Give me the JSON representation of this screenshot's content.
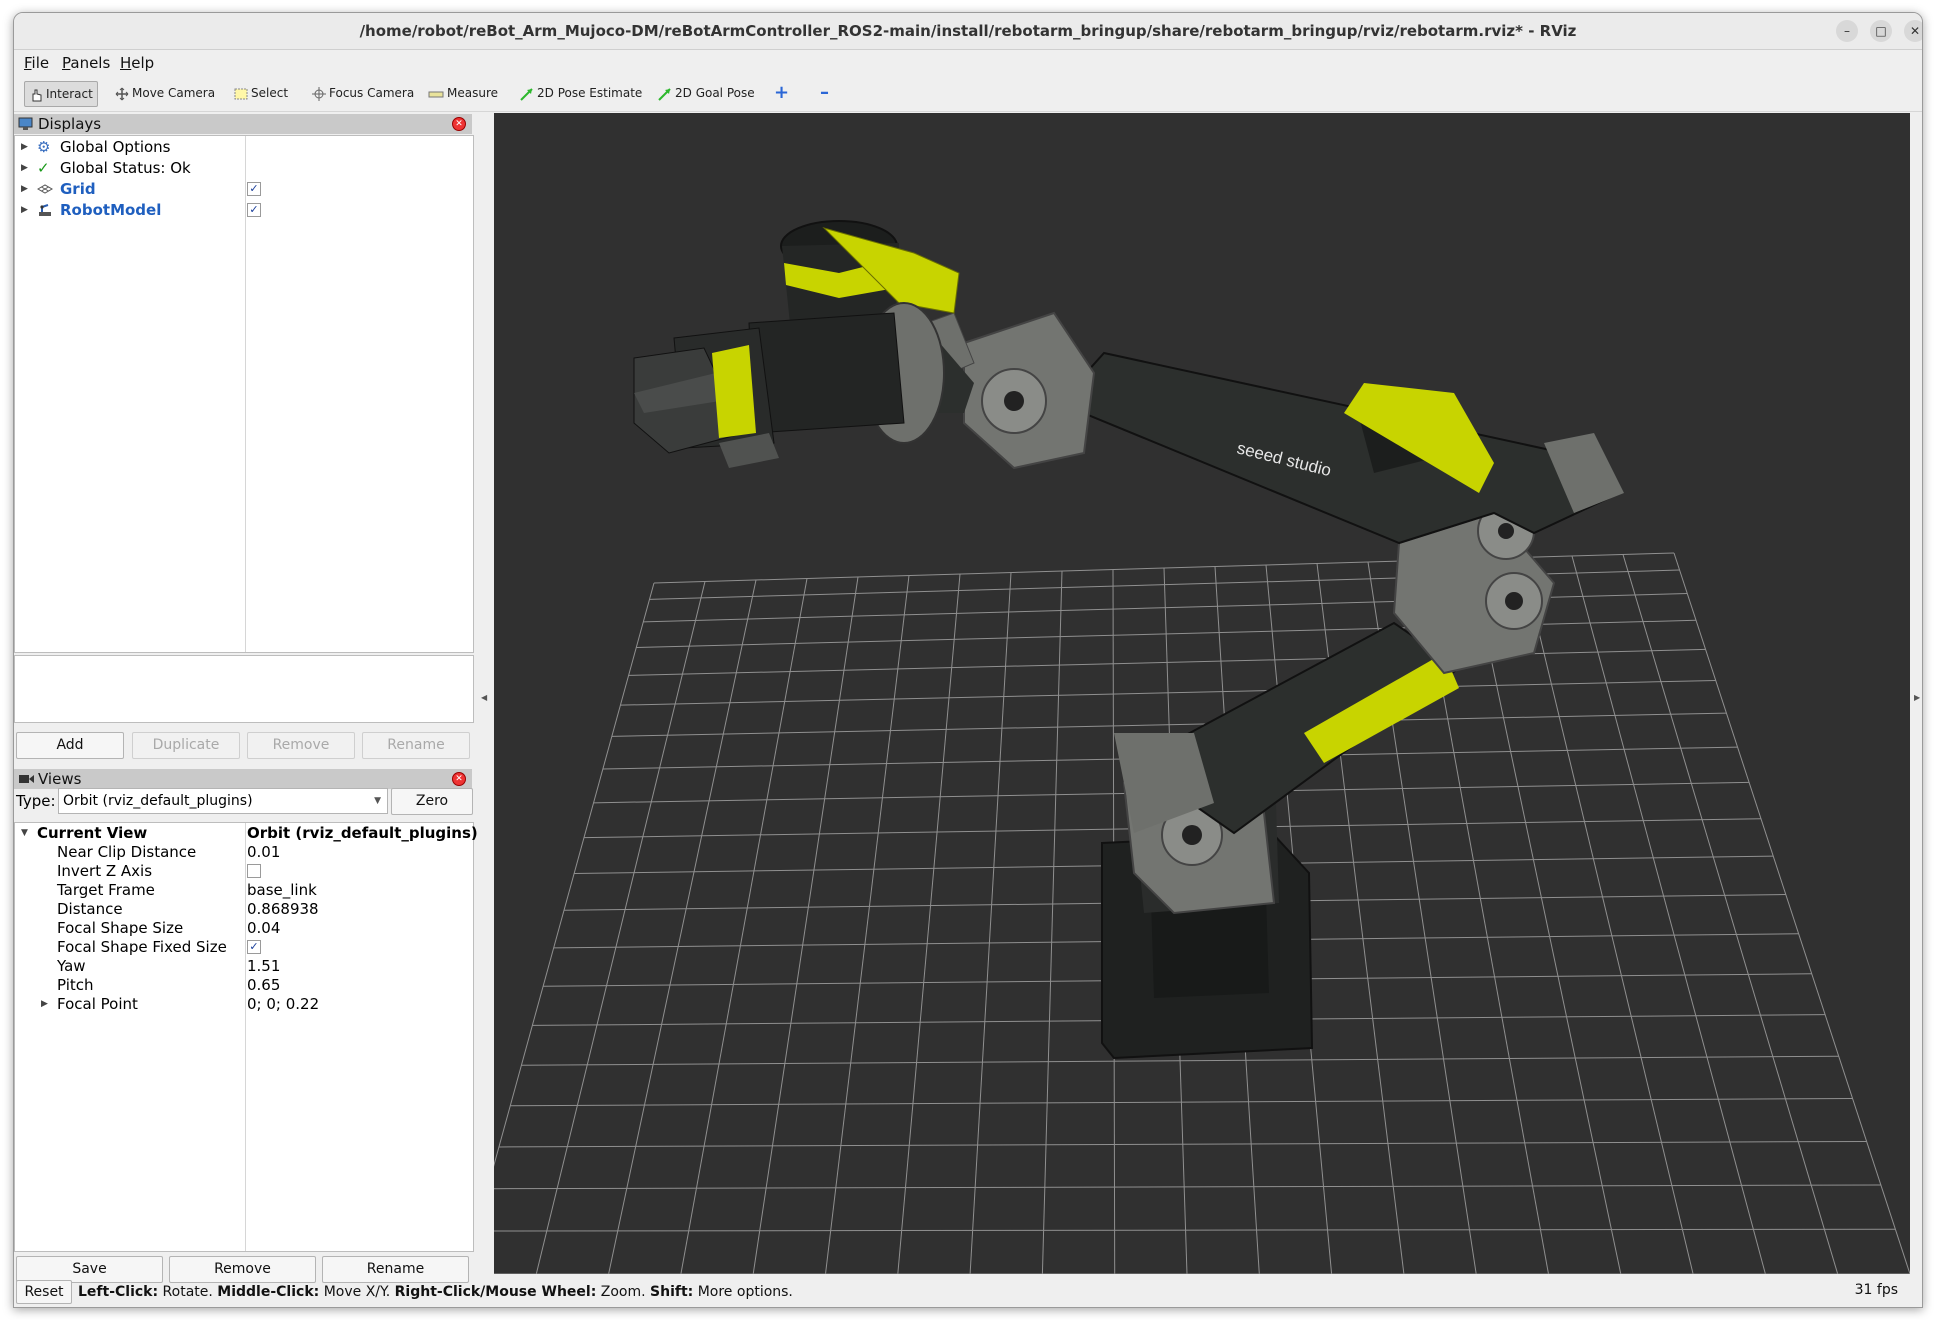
{
  "window": {
    "title": "/home/robot/reBot_Arm_Mujoco-DM/reBotArmController_ROS2-main/install/rebotarm_bringup/share/rebotarm_bringup/rviz/rebotarm.rviz* - RViz",
    "controls": [
      "–",
      "□",
      "✕"
    ]
  },
  "menubar": {
    "items": [
      {
        "key": "F",
        "rest": "ile"
      },
      {
        "key": "P",
        "rest": "anels"
      },
      {
        "key": "H",
        "rest": "elp"
      }
    ]
  },
  "toolbar": {
    "interact": "Interact",
    "move_camera": "Move Camera",
    "select": "Select",
    "focus_camera": "Focus Camera",
    "measure": "Measure",
    "pose_estimate": "2D Pose Estimate",
    "goal_pose": "2D Goal Pose",
    "add_tool": "+",
    "remove_tool": "–"
  },
  "colors": {
    "viewport_bg": "#303030",
    "grid_line": "#a0a0a0",
    "robot_accent": "#c8d400",
    "robot_body": "#2a2d2c",
    "robot_plate": "#6e706c",
    "link_blue": "#1f5fbf"
  },
  "displays": {
    "title": "Displays",
    "items": [
      {
        "label": "Global Options",
        "icon": "gear-icon"
      },
      {
        "label": "Global Status: Ok",
        "icon": "checkmark-icon"
      },
      {
        "label": "Grid",
        "icon": "grid-icon",
        "checked": "✓"
      },
      {
        "label": "RobotModel",
        "icon": "robot-icon",
        "checked": "✓"
      }
    ],
    "buttons": {
      "add": "Add",
      "duplicate": "Duplicate",
      "remove": "Remove",
      "rename": "Rename"
    }
  },
  "views": {
    "title": "Views",
    "type_label": "Type:",
    "type_value": "Orbit (rviz_default_plugins)",
    "zero": "Zero",
    "current_view": {
      "label": "Current View",
      "value": "Orbit (rviz_default_plugins)"
    },
    "properties": [
      {
        "label": "Near Clip Distance",
        "value": "0.01"
      },
      {
        "label": "Invert Z Axis",
        "value": ""
      },
      {
        "label": "Target Frame",
        "value": "base_link"
      },
      {
        "label": "Distance",
        "value": "0.868938"
      },
      {
        "label": "Focal Shape Size",
        "value": "0.04"
      },
      {
        "label": "Focal Shape Fixed Size",
        "value": "✓"
      },
      {
        "label": "Yaw",
        "value": "1.51"
      },
      {
        "label": "Pitch",
        "value": "0.65"
      },
      {
        "label": "Focal Point",
        "value": "0; 0; 0.22"
      }
    ],
    "buttons": {
      "save": "Save",
      "remove": "Remove",
      "rename": "Rename"
    }
  },
  "viewport": {
    "brand_text": "seeed studio"
  },
  "status": {
    "reset": "Reset",
    "hints": [
      {
        "key": "Left-Click:",
        "text": " Rotate. "
      },
      {
        "key": "Middle-Click:",
        "text": " Move X/Y. "
      },
      {
        "key": "Right-Click/Mouse Wheel:",
        "text": " Zoom. "
      },
      {
        "key": "Shift:",
        "text": " More options."
      }
    ],
    "fps": "31 fps"
  }
}
